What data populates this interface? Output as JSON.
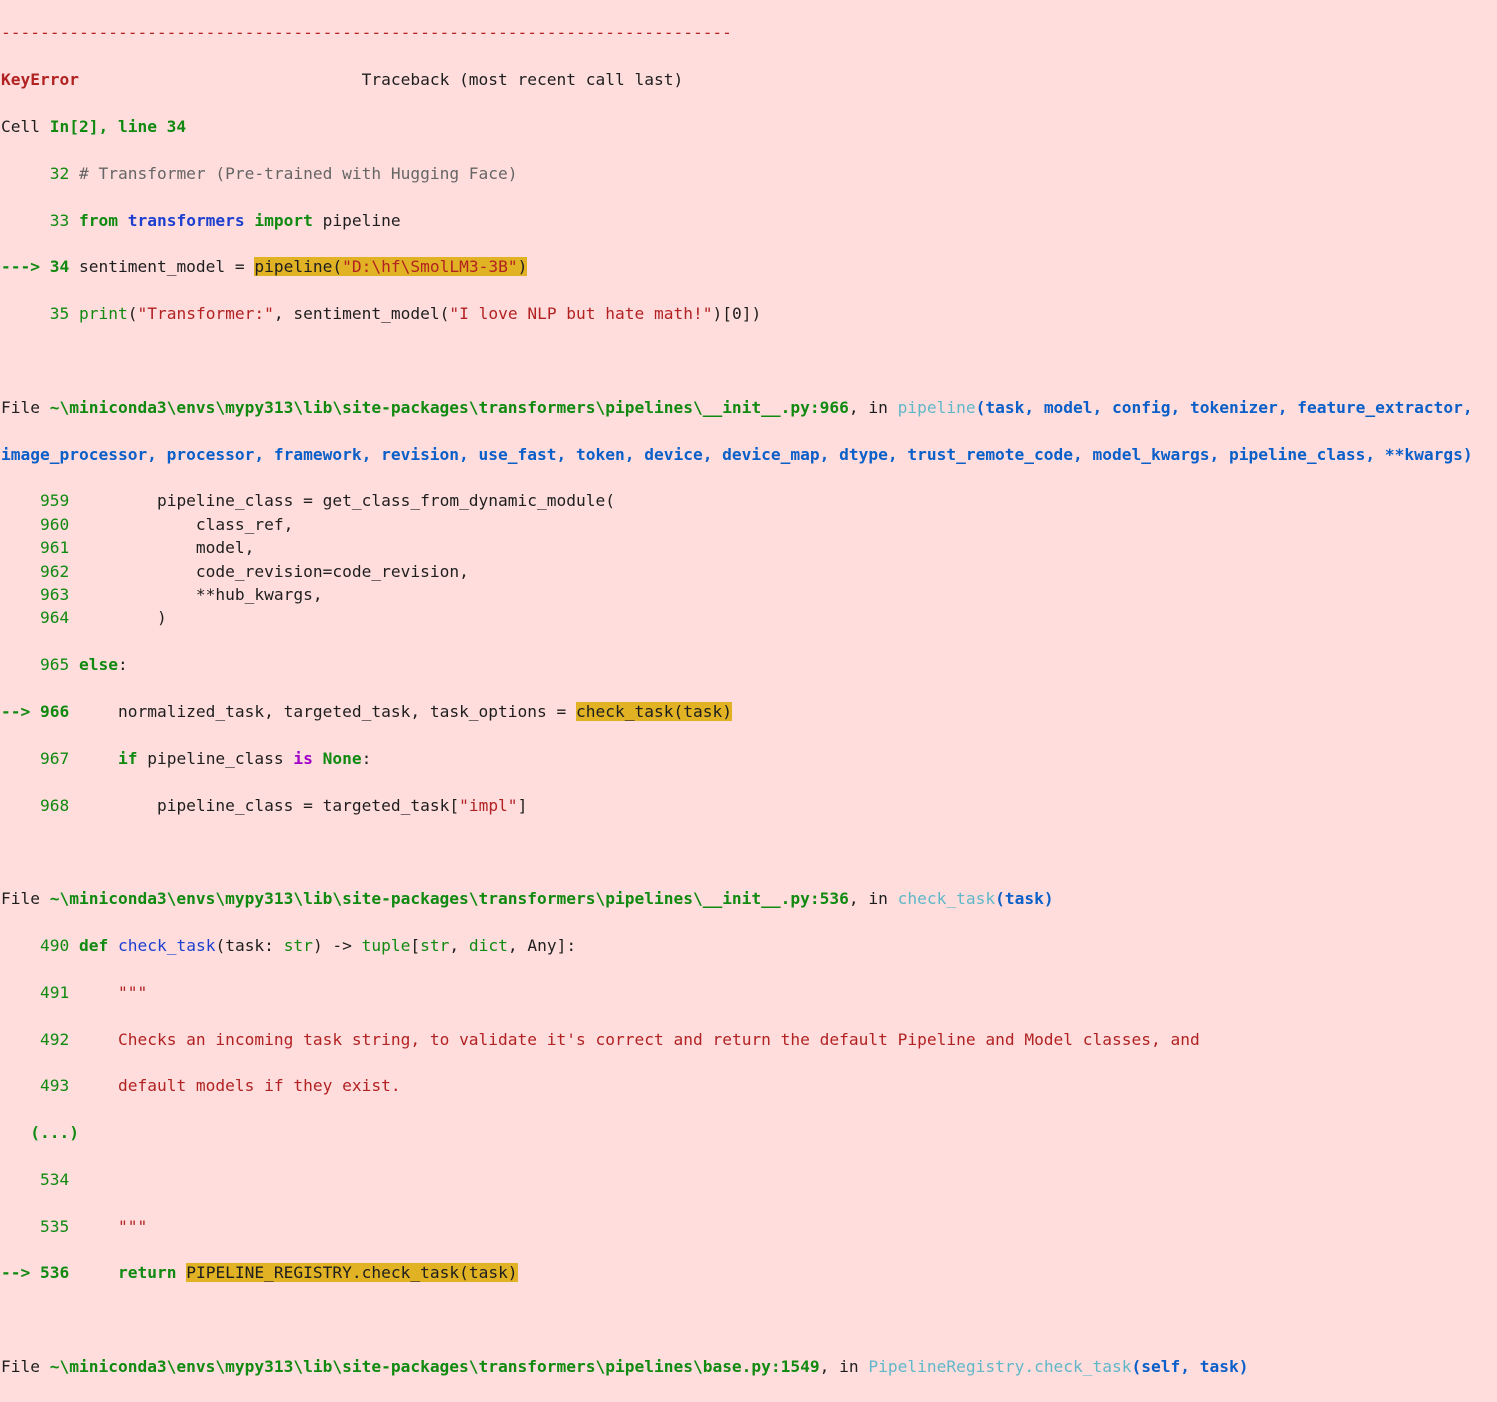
{
  "header": {
    "separator": "---------------------------------------------------------------------------",
    "error_name": "KeyError",
    "traceback_label": "Traceback (most recent call last)",
    "cell_prefix": "Cell ",
    "cell_ref": "In[2], line 34"
  },
  "frame1": {
    "l32_no": "32",
    "l32_text": "# Transformer (Pre-trained with Hugging Face)",
    "l33_no": "33",
    "l33_from": "from",
    "l33_module": "transformers",
    "l33_import": "import",
    "l33_name": "pipeline",
    "l34_arrow": "---> 34",
    "l34_pre": "sentiment_model = ",
    "l34_call": "pipeline(",
    "l34_arg": "\"D:\\hf\\SmolLM3-3B\"",
    "l34_close": ")",
    "l35_no": "35",
    "l35_print": "print",
    "l35_open": "(",
    "l35_str1": "\"Transformer:\"",
    "l35_mid": ", sentiment_model(",
    "l35_str2": "\"I love NLP but hate math!\"",
    "l35_end": ")[0])"
  },
  "frame2": {
    "file_prefix": "File ",
    "path": "~\\miniconda3\\envs\\mypy313\\lib\\site-packages\\transformers\\pipelines\\__init__.py:966",
    "in_text": ", in ",
    "func": "pipeline",
    "args_line1": "(task, model, config, tokenizer, feature_extractor,",
    "args_line2": "image_processor, processor, framework, revision, use_fast, token, device, device_map, dtype, trust_remote_code, model_kwargs, pipeline_class, **kwargs)",
    "lines": [
      {
        "no": "959",
        "code": "        pipeline_class = get_class_from_dynamic_module("
      },
      {
        "no": "960",
        "code": "            class_ref,"
      },
      {
        "no": "961",
        "code": "            model,"
      },
      {
        "no": "962",
        "code": "            code_revision=code_revision,"
      },
      {
        "no": "963",
        "code": "            **hub_kwargs,"
      },
      {
        "no": "964",
        "code": "        )"
      }
    ],
    "l965_no": "965",
    "l965_kw": "else",
    "l965_colon": ":",
    "l966_arrow": "--> 966",
    "l966_pre": "    normalized_task, targeted_task, task_options = ",
    "l966_call": "check_task(task)",
    "l967_no": "967",
    "l967_indent": "    ",
    "l967_if": "if",
    "l967_mid": " pipeline_class ",
    "l967_is": "is",
    "l967_sp": " ",
    "l967_none": "None",
    "l967_colon": ":",
    "l968_no": "968",
    "l968_pre": "        pipeline_class = targeted_task[",
    "l968_str": "\"impl\"",
    "l968_end": "]"
  },
  "frame3": {
    "file_prefix": "File ",
    "path": "~\\miniconda3\\envs\\mypy313\\lib\\site-packages\\transformers\\pipelines\\__init__.py:536",
    "in_text": ", in ",
    "func": "check_task",
    "args": "(task)",
    "l490_no": "490",
    "l490_def": "def",
    "l490_sp": " ",
    "l490_fn": "check_task",
    "l490_rest1": "(task: ",
    "l490_str": "str",
    "l490_rest2": ") -> ",
    "l490_tuple": "tuple",
    "l490_rest3": "[",
    "l490_str2": "str",
    "l490_rest4": ", ",
    "l490_dict": "dict",
    "l490_rest5": ", Any]:",
    "l491_no": "491",
    "l491_text": "    \"\"\"",
    "l492_no": "492",
    "l492_text": "    Checks an incoming task string, to validate it's correct and return the default Pipeline and Model classes, and",
    "l493_no": "493",
    "l493_text": "    default models if they exist.",
    "ellipsis": "(...)",
    "l534_no": "534",
    "l535_no": "535",
    "l535_text": "    \"\"\"",
    "l536_arrow": "--> 536",
    "l536_indent": "    ",
    "l536_return": "return",
    "l536_sp": " ",
    "l536_call": "PIPELINE_REGISTRY.check_task(task)"
  },
  "frame4": {
    "file_prefix": "File ",
    "path": "~\\miniconda3\\envs\\mypy313\\lib\\site-packages\\transformers\\pipelines\\base.py:1549",
    "in_text": ", in ",
    "func": "PipelineRegistry.check_task",
    "args": "(self, task)"
  }
}
